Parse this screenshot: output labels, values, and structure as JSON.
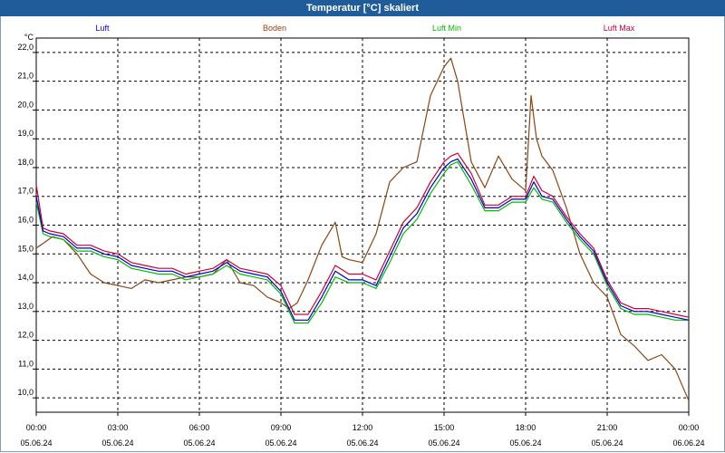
{
  "window": {
    "title": "Temperatur [°C] skaliert"
  },
  "chart_data": {
    "type": "line",
    "ylabel": "°C",
    "ylim": [
      9.5,
      22.5
    ],
    "y_ticks": [
      "10,0",
      "11,0",
      "12,0",
      "13,0",
      "14,0",
      "15,0",
      "16,0",
      "17,0",
      "18,0",
      "19,0",
      "20,0",
      "21,0",
      "22,0"
    ],
    "x_range_hours": [
      0,
      24
    ],
    "x_ticks": [
      {
        "time": "00:00",
        "date": "05.06.24"
      },
      {
        "time": "03:00",
        "date": "05.06.24"
      },
      {
        "time": "06:00",
        "date": "05.06.24"
      },
      {
        "time": "09:00",
        "date": "05.06.24"
      },
      {
        "time": "12:00",
        "date": "05.06.24"
      },
      {
        "time": "15:00",
        "date": "05.06.24"
      },
      {
        "time": "18:00",
        "date": "05.06.24"
      },
      {
        "time": "21:00",
        "date": "05.06.24"
      },
      {
        "time": "00:00",
        "date": "06.06.24"
      }
    ],
    "grid": true,
    "legend_position": "top",
    "series": [
      {
        "name": "Luft",
        "color": "#0000cc",
        "x": [
          0,
          0.25,
          0.5,
          1,
          1.5,
          2,
          2.5,
          3,
          3.5,
          4,
          4.5,
          5,
          5.5,
          6,
          6.5,
          7,
          7.5,
          8,
          8.5,
          9,
          9.5,
          10,
          10.5,
          11,
          11.5,
          12,
          12.5,
          13,
          13.5,
          14,
          14.5,
          15,
          15.25,
          15.5,
          16,
          16.5,
          17,
          17.5,
          18,
          18.3,
          18.6,
          19,
          19.5,
          20,
          20.5,
          21,
          21.5,
          22,
          22.5,
          23,
          23.5,
          24
        ],
        "y": [
          17.0,
          15.8,
          15.7,
          15.6,
          15.2,
          15.2,
          15.0,
          14.9,
          14.6,
          14.5,
          14.4,
          14.4,
          14.2,
          14.3,
          14.4,
          14.7,
          14.4,
          14.3,
          14.2,
          13.7,
          12.7,
          12.7,
          13.5,
          14.4,
          14.1,
          14.1,
          13.9,
          14.9,
          15.9,
          16.4,
          17.3,
          18.0,
          18.2,
          18.3,
          17.6,
          16.6,
          16.6,
          16.9,
          16.9,
          17.5,
          17.0,
          16.9,
          16.2,
          15.6,
          15.1,
          14.0,
          13.2,
          13.0,
          13.0,
          12.9,
          12.8,
          12.7
        ]
      },
      {
        "name": "Boden",
        "color": "#8b4513",
        "x": [
          0,
          0.3,
          0.6,
          1,
          1.5,
          2,
          2.5,
          3,
          3.5,
          4,
          4.5,
          5,
          5.5,
          6,
          6.5,
          7,
          7.5,
          8,
          8.5,
          9,
          9.3,
          9.6,
          10,
          10.5,
          11,
          11.25,
          11.5,
          12,
          12.5,
          13,
          13.5,
          14,
          14.5,
          15,
          15.25,
          15.5,
          16,
          16.5,
          17,
          17.5,
          18,
          18.2,
          18.4,
          18.6,
          19,
          19.5,
          20,
          20.5,
          21,
          21.5,
          22,
          22.5,
          23,
          23.5,
          24
        ],
        "y": [
          15.2,
          15.4,
          15.6,
          15.5,
          15.0,
          14.3,
          14.0,
          13.9,
          13.8,
          14.1,
          14.0,
          14.1,
          14.2,
          14.2,
          14.3,
          14.8,
          14.0,
          13.9,
          13.5,
          13.3,
          13.1,
          13.3,
          14.1,
          15.3,
          16.1,
          14.9,
          14.8,
          14.7,
          15.7,
          17.5,
          18.0,
          18.2,
          20.5,
          21.5,
          21.8,
          21.0,
          18.2,
          17.3,
          18.4,
          17.6,
          17.2,
          20.5,
          19.0,
          18.4,
          17.9,
          16.6,
          15.0,
          14.0,
          13.5,
          12.2,
          11.8,
          11.3,
          11.5,
          11.0,
          9.9
        ]
      },
      {
        "name": "Luft Min",
        "color": "#00bb00",
        "x": [
          0,
          0.25,
          0.5,
          1,
          1.5,
          2,
          2.5,
          3,
          3.5,
          4,
          4.5,
          5,
          5.5,
          6,
          6.5,
          7,
          7.5,
          8,
          8.5,
          9,
          9.5,
          10,
          10.5,
          11,
          11.5,
          12,
          12.5,
          13,
          13.5,
          14,
          14.5,
          15,
          15.25,
          15.5,
          16,
          16.5,
          17,
          17.5,
          18,
          18.3,
          18.6,
          19,
          19.5,
          20,
          20.5,
          21,
          21.5,
          22,
          22.5,
          23,
          23.5,
          24
        ],
        "y": [
          16.8,
          15.7,
          15.6,
          15.5,
          15.1,
          15.1,
          14.9,
          14.8,
          14.5,
          14.4,
          14.3,
          14.3,
          14.1,
          14.2,
          14.3,
          14.6,
          14.3,
          14.2,
          14.1,
          13.6,
          12.6,
          12.6,
          13.3,
          14.2,
          14.0,
          14.0,
          13.8,
          14.7,
          15.7,
          16.2,
          17.1,
          17.8,
          18.1,
          18.2,
          17.4,
          16.5,
          16.5,
          16.8,
          16.8,
          17.3,
          16.9,
          16.8,
          16.1,
          15.5,
          15.0,
          13.9,
          13.1,
          12.9,
          12.9,
          12.8,
          12.7,
          12.7
        ]
      },
      {
        "name": "Luft Max",
        "color": "#cc0033",
        "x": [
          0,
          0.25,
          0.5,
          1,
          1.5,
          2,
          2.5,
          3,
          3.5,
          4,
          4.5,
          5,
          5.5,
          6,
          6.5,
          7,
          7.5,
          8,
          8.5,
          9,
          9.5,
          10,
          10.5,
          11,
          11.5,
          12,
          12.5,
          13,
          13.5,
          14,
          14.5,
          15,
          15.25,
          15.5,
          16,
          16.5,
          17,
          17.5,
          18,
          18.3,
          18.6,
          19,
          19.5,
          20,
          20.5,
          21,
          21.5,
          22,
          22.5,
          23,
          23.5,
          24
        ],
        "y": [
          17.4,
          15.9,
          15.8,
          15.7,
          15.3,
          15.3,
          15.1,
          15.0,
          14.7,
          14.6,
          14.5,
          14.5,
          14.3,
          14.4,
          14.5,
          14.8,
          14.5,
          14.4,
          14.3,
          13.9,
          12.9,
          12.9,
          13.7,
          14.6,
          14.3,
          14.3,
          14.1,
          15.1,
          16.1,
          16.6,
          17.5,
          18.2,
          18.4,
          18.5,
          17.8,
          16.7,
          16.7,
          17.0,
          17.0,
          17.7,
          17.2,
          17.0,
          16.3,
          15.7,
          15.2,
          14.1,
          13.3,
          13.1,
          13.1,
          13.0,
          12.9,
          12.8
        ]
      }
    ]
  }
}
